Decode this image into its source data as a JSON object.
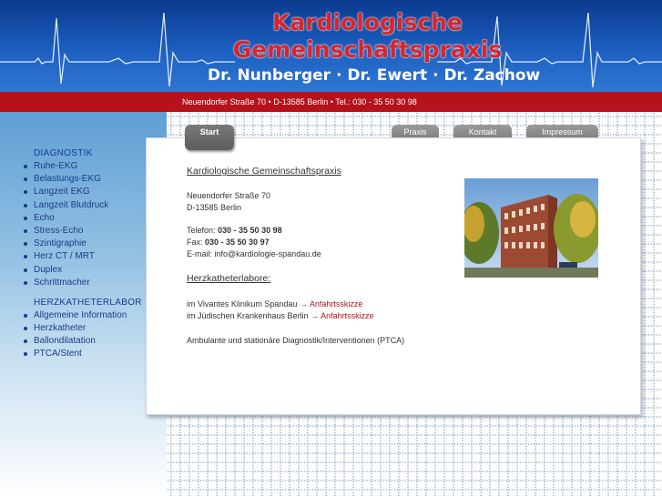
{
  "header": {
    "title_line1": "Kardiologische",
    "title_line2": "Gemeinschaftspraxis",
    "doctors": "Dr. Nunberger · Dr. Ewert · Dr. Zachow"
  },
  "address_bar": "Neuendorfer Straße 70 • D-13585 Berlin • Tel.: 030 - 35 50 30 98",
  "sidebar": {
    "section1": "DIAGNOSTIK",
    "items1": [
      "Ruhe-EKG",
      "Belastungs-EKG",
      "Langzeit EKG",
      "Langzeit Blutdruck",
      "Echo",
      "Stress-Echo",
      "Szintigraphie",
      "Herz CT / MRT",
      "Duplex",
      "Schrittmacher"
    ],
    "section2": "HERZKATHETERLABOR",
    "items2": [
      "Allgemeine Information",
      "Herzkatheter",
      "Ballondilatation",
      "PTCA/Stent"
    ]
  },
  "tabs": {
    "start": "Start",
    "praxis": "Praxis",
    "kontakt": "Kontakt",
    "impressum": "Impressum"
  },
  "content": {
    "title": "Kardiologische Gemeinschaftspraxis",
    "street": "Neuendorfer Straße 70",
    "city": "D-13585 Berlin",
    "phone_label": "Telefon: ",
    "phone": "030 - 35 50 30 98",
    "fax_label": "Fax: ",
    "fax": "030 - 35 50 30 97",
    "email": "E-mail: info@kardiologie-spandau.de",
    "labs_heading": "Herzkatheterlabore:",
    "lab1": "im Vivantes Klinikum Spandau ",
    "lab1_link": "→ Anfahrtsskizze",
    "lab2": "im Jüdischen Krankenhaus Berlin ",
    "lab2_link": "→ Anfahrtsskizze",
    "services": "Ambulante und stationäre Diagnostik/Interventionen (PTCA)"
  },
  "colors": {
    "header_blue": "#1d5fc0",
    "title_red": "#d9242b",
    "bar_red": "#b5121b",
    "menu_blue": "#1a3a8a"
  }
}
